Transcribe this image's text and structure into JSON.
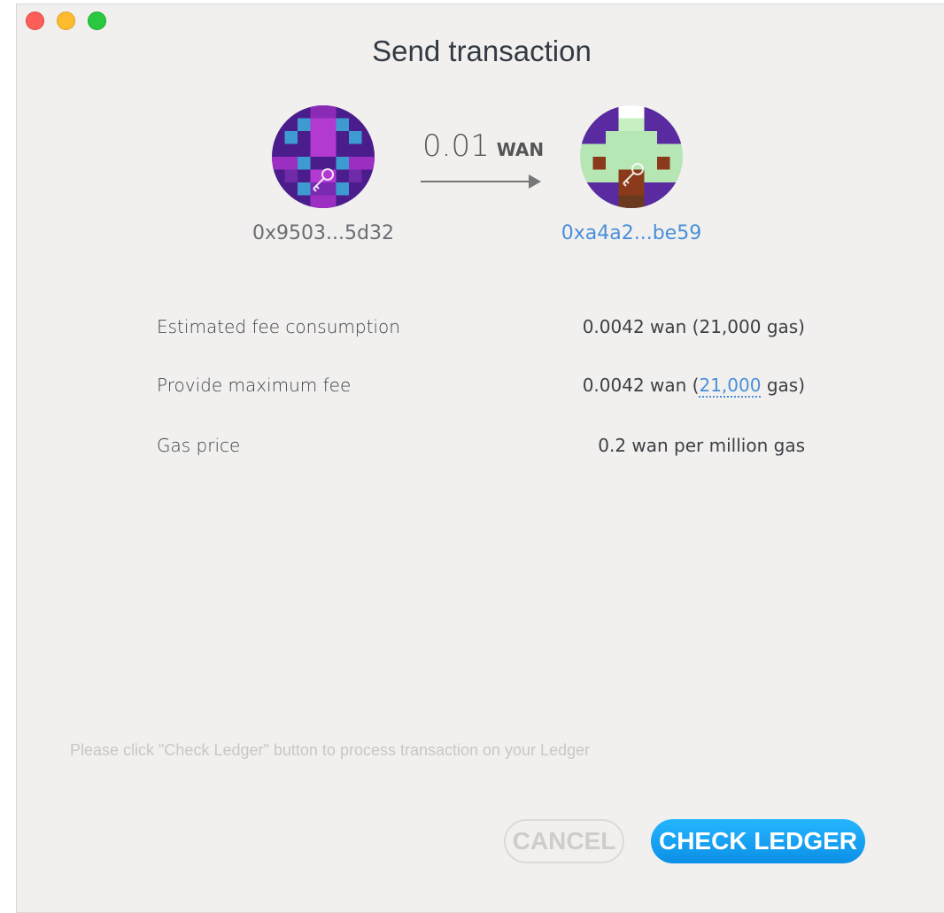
{
  "window": {
    "title": "Send transaction"
  },
  "transfer": {
    "from_address": "0x9503...5d32",
    "to_address": "0xa4a2...be59",
    "amount": "0.01",
    "unit": "WAN"
  },
  "fees": {
    "estimated": {
      "label": "Estimated fee consumption",
      "value": "0.0042 wan (21,000 gas)"
    },
    "maximum": {
      "label": "Provide maximum fee",
      "value_prefix": "0.0042 wan (",
      "gas_link": "21,000",
      "value_suffix": " gas)"
    },
    "gas_price": {
      "label": "Gas price",
      "value": "0.2 wan per million gas"
    }
  },
  "hint": "Please click \"Check Ledger\" button to process transaction on your Ledger",
  "buttons": {
    "cancel": "CANCEL",
    "check_ledger": "CHECK LEDGER"
  },
  "colors": {
    "link": "#4a8fd9",
    "primary_button": "#0b8fe6",
    "background": "#f1f0ef"
  },
  "icons": {
    "from_avatar": "identicon-from",
    "to_avatar": "identicon-to",
    "arrow": "arrow-right-icon",
    "key": "key-icon"
  }
}
